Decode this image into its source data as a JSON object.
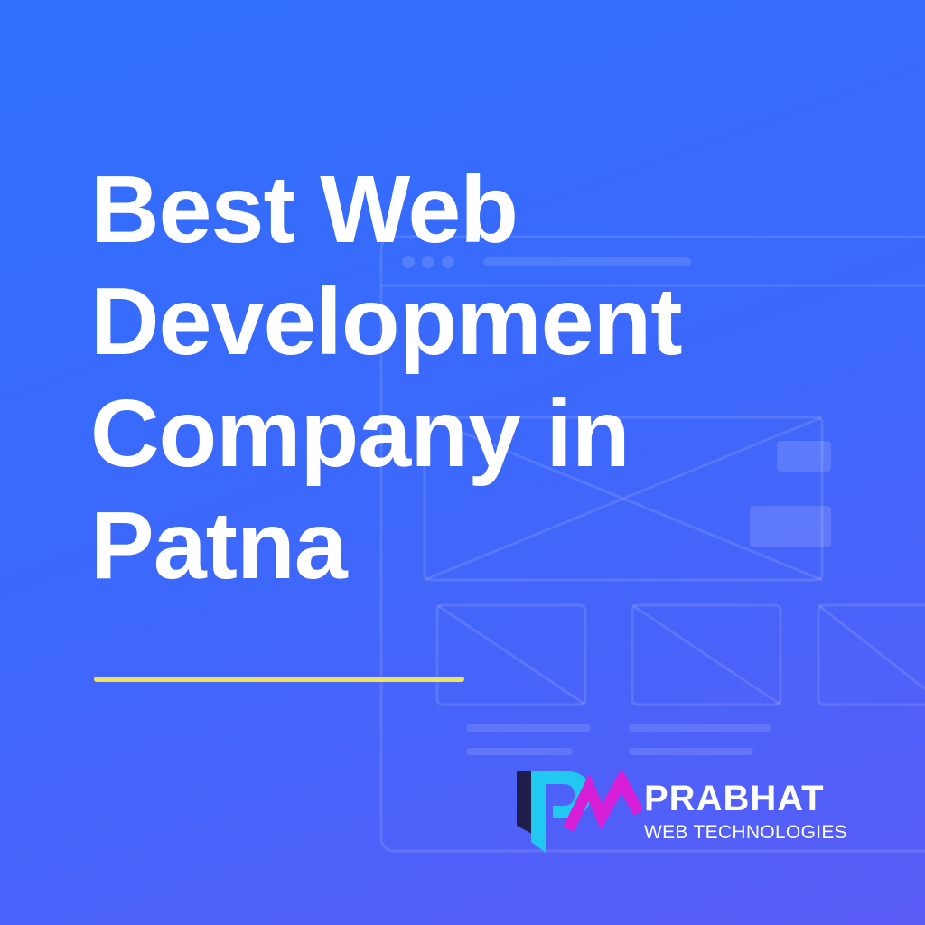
{
  "headline": {
    "lines": [
      "Best  Web",
      "Development",
      "Company in",
      "Patna"
    ]
  },
  "brand": {
    "name": "PRABHAT",
    "tagline": "WEB TECHNOLOGIES",
    "logo_icon": "pw-monogram-icon"
  },
  "colors": {
    "background_start": "#2f6ffb",
    "background_end": "#5a5cf6",
    "headline_text": "#ffffff",
    "underline_accent": "#f2e35c",
    "logo_dark": "#1f1d4a",
    "logo_cyan": "#21c8ef",
    "logo_magenta": "#d61fd6"
  }
}
